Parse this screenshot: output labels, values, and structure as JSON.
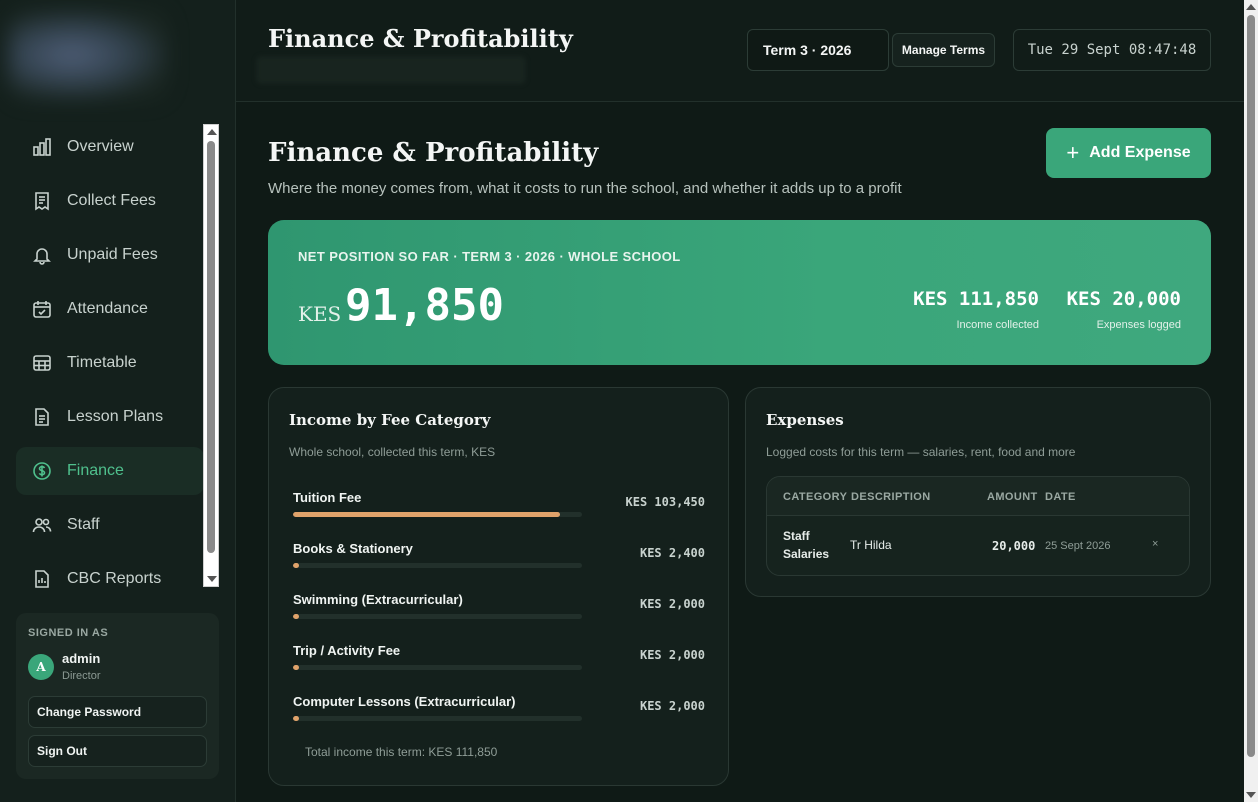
{
  "header": {
    "title": "Finance & Profitability",
    "term": "Term 3 · 2026",
    "manage_terms": "Manage Terms",
    "clock": "Tue 29 Sept 08:47:48"
  },
  "sidebar": {
    "items": [
      {
        "label": "Overview",
        "icon": "bar-chart-icon"
      },
      {
        "label": "Collect Fees",
        "icon": "receipt-icon"
      },
      {
        "label": "Unpaid Fees",
        "icon": "bell-icon"
      },
      {
        "label": "Attendance",
        "icon": "calendar-check-icon"
      },
      {
        "label": "Timetable",
        "icon": "grid-table-icon"
      },
      {
        "label": "Lesson Plans",
        "icon": "document-icon"
      },
      {
        "label": "Finance",
        "icon": "dollar-circle-icon",
        "active": true
      },
      {
        "label": "Staff",
        "icon": "users-icon"
      },
      {
        "label": "CBC Reports",
        "icon": "report-icon"
      }
    ],
    "user": {
      "signed_in_as": "SIGNED IN AS",
      "initial": "A",
      "name": "admin",
      "role": "Director",
      "change_password": "Change Password",
      "sign_out": "Sign Out"
    }
  },
  "main": {
    "title": "Finance & Profitability",
    "subtitle": "Where the money comes from, what it costs to run the school, and whether it adds up to a profit",
    "add_expense": "Add Expense",
    "hero": {
      "label": "NET POSITION SO FAR · TERM 3 · 2026 · WHOLE SCHOOL",
      "currency": "KES",
      "net": "91,850",
      "income_value": "KES 111,850",
      "income_label": "Income collected",
      "expenses_value": "KES 20,000",
      "expenses_label": "Expenses logged"
    },
    "income": {
      "title": "Income by Fee Category",
      "subtitle": "Whole school, collected this term, KES",
      "rows": [
        {
          "name": "Tuition Fee",
          "value": "KES 103,450",
          "share": 0.925
        },
        {
          "name": "Books & Stationery",
          "value": "KES 2,400",
          "share": 0.021
        },
        {
          "name": "Swimming (Extracurricular)",
          "value": "KES 2,000",
          "share": 0.018
        },
        {
          "name": "Trip / Activity Fee",
          "value": "KES 2,000",
          "share": 0.018
        },
        {
          "name": "Computer Lessons (Extracurricular)",
          "value": "KES 2,000",
          "share": 0.018
        }
      ],
      "total": "Total income this term: KES 111,850"
    },
    "expenses": {
      "title": "Expenses",
      "subtitle": "Logged costs for this term — salaries, rent, food and more",
      "columns": [
        "CATEGORY",
        "DESCRIPTION",
        "AMOUNT",
        "DATE"
      ],
      "rows": [
        {
          "category_line1": "Staff",
          "category_line2": "Salaries",
          "description": "Tr Hilda",
          "amount": "20,000",
          "date": "25 Sept 2026",
          "delete": "×"
        }
      ]
    }
  },
  "colors": {
    "accent": "#3aa67a",
    "bar": "#e0a36b",
    "background": "#0f1a16"
  }
}
